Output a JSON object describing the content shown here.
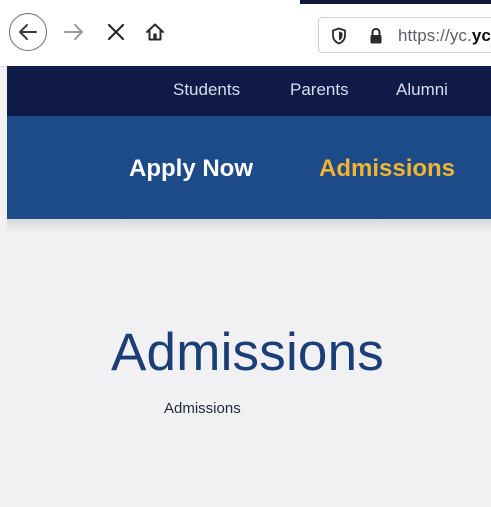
{
  "browser": {
    "url_prefix": "https://yc.",
    "url_domain_visible": "yc",
    "icons": {
      "back": "arrow-left-icon",
      "forward": "arrow-right-icon",
      "stop": "close-icon",
      "home": "home-icon",
      "tracking": "shield-icon",
      "secure": "lock-icon"
    }
  },
  "site": {
    "utility_nav": [
      "Students",
      "Parents",
      "Alumni"
    ],
    "main_nav": {
      "apply": "Apply Now",
      "admissions": "Admissions"
    },
    "colors": {
      "utility_bg": "#0f1a47",
      "main_nav_bg": "#1d4b8a",
      "admissions_accent": "#f3b531",
      "title_color": "#1a3e75"
    }
  },
  "page": {
    "title": "Admissions",
    "breadcrumb": "Admissions"
  }
}
